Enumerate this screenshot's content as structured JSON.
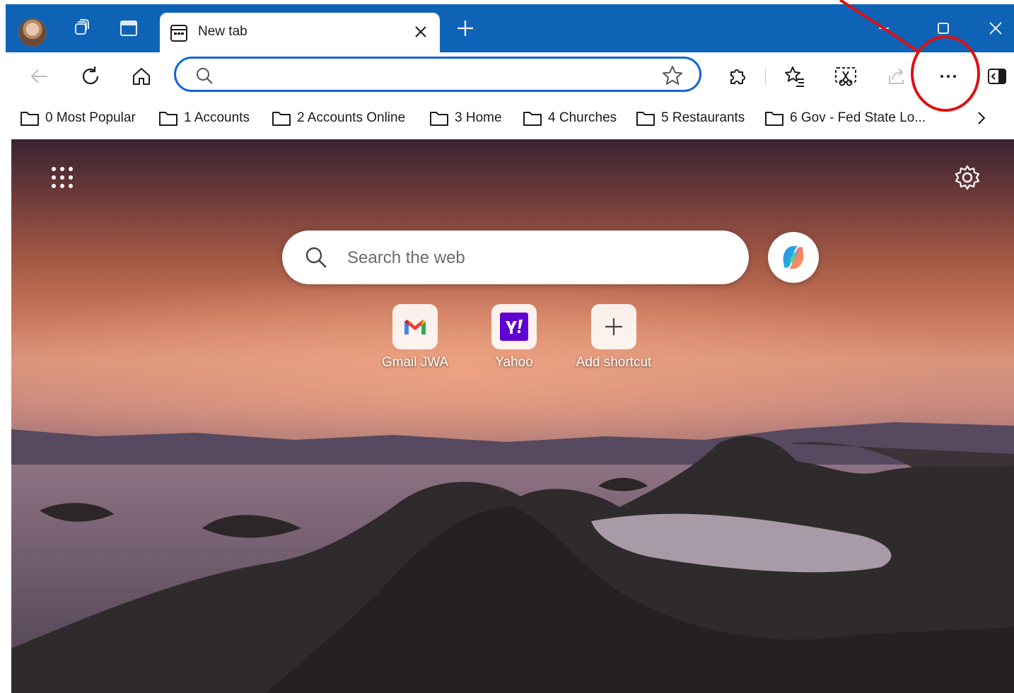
{
  "browser": {
    "tab": {
      "title": "New tab"
    },
    "address_bar": {
      "value": "",
      "placeholder": ""
    },
    "bookmarks": [
      {
        "label": "0 Most Popular"
      },
      {
        "label": "1 Accounts"
      },
      {
        "label": "2 Accounts Online"
      },
      {
        "label": "3 Home"
      },
      {
        "label": "4 Churches"
      },
      {
        "label": "5 Restaurants"
      },
      {
        "label": "6 Gov - Fed State Lo..."
      }
    ]
  },
  "new_tab": {
    "search": {
      "placeholder": "Search the web",
      "value": ""
    },
    "shortcuts": [
      {
        "label": "Gmail JWA",
        "icon": "gmail-icon"
      },
      {
        "label": "Yahoo",
        "icon": "yahoo-icon"
      },
      {
        "label": "Add shortcut",
        "icon": "plus-icon"
      }
    ]
  },
  "colors": {
    "titlebar": "#0f63b7",
    "address_border": "#1565d8",
    "annotation": "#e01010",
    "yahoo_purple": "#6001d2"
  }
}
